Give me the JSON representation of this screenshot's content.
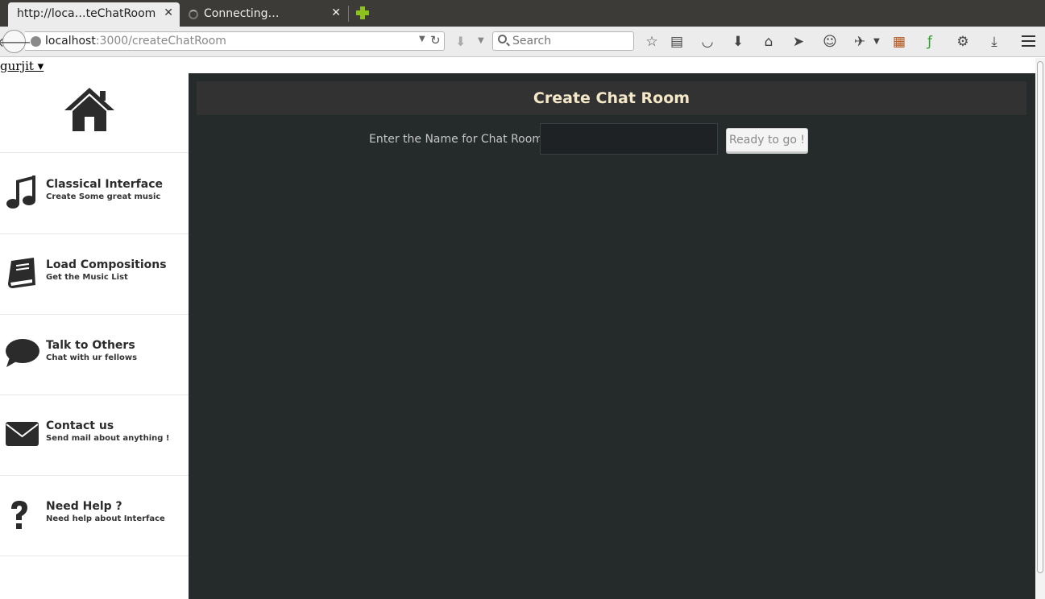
{
  "browser": {
    "tabs": [
      {
        "title": "http://loca…teChatRoom",
        "close": "✕"
      },
      {
        "title": "Connecting…",
        "close": "✕"
      }
    ],
    "url": {
      "host": "localhost",
      "path": ":3000/createChatRoom"
    },
    "search": {
      "placeholder": "Search"
    }
  },
  "page": {
    "user_menu": "gurjit ▾",
    "sidebar": {
      "items": [
        {
          "title": "Classical Interface",
          "subtitle": "Create Some great music",
          "icon": "music-note-icon"
        },
        {
          "title": "Load Compositions",
          "subtitle": "Get the Music List",
          "icon": "book-icon"
        },
        {
          "title": "Talk to Others",
          "subtitle": "Chat with ur fellows",
          "icon": "chat-bubble-icon"
        },
        {
          "title": "Contact us",
          "subtitle": "Send mail about anything !",
          "icon": "envelope-icon"
        },
        {
          "title": "Need Help ?",
          "subtitle": "Need help about Interface",
          "icon": "question-icon"
        }
      ]
    },
    "main": {
      "title": "Create Chat Room",
      "form_label": "Enter the Name for Chat Room :",
      "input_value": "",
      "button_label": "Ready to go !"
    }
  },
  "colors": {
    "main_bg": "#252a2b",
    "header_bg": "#323232",
    "title_color": "#f5e8c8",
    "icon_color": "#2b2b2b"
  }
}
